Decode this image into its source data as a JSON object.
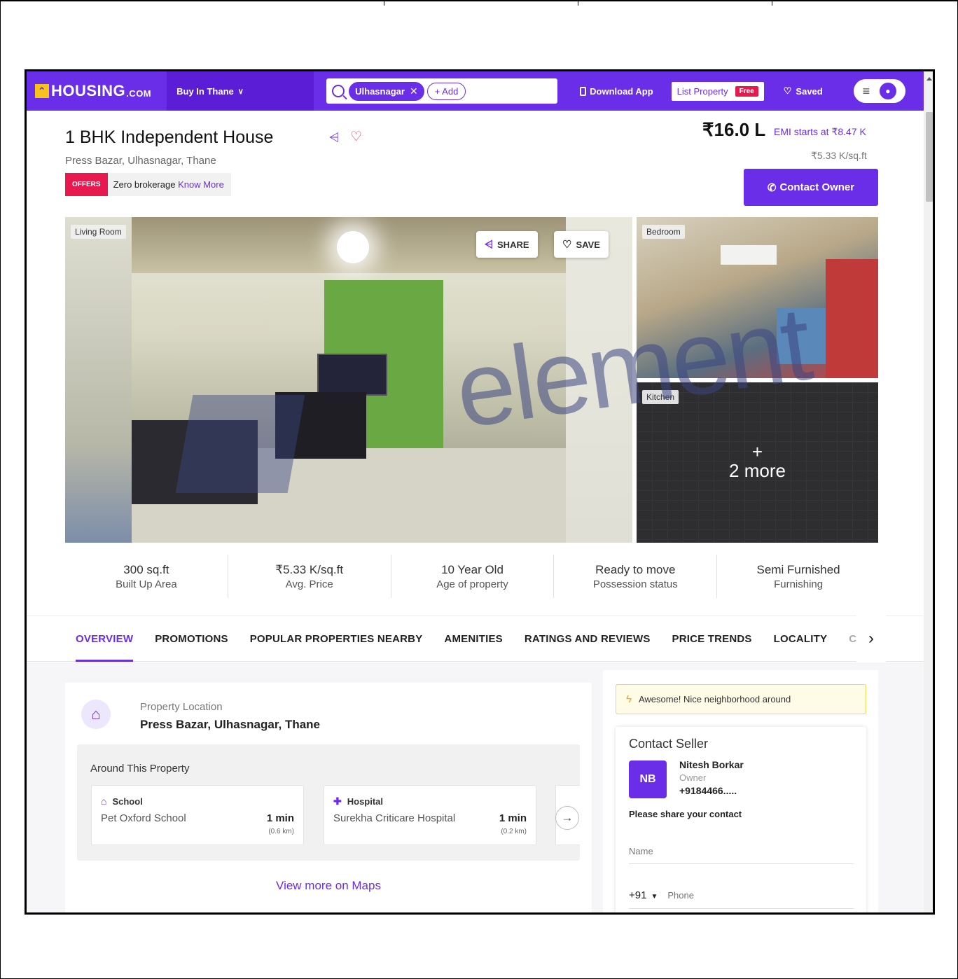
{
  "nav": {
    "logo_text": "HOUSING",
    "logo_suffix": ".COM",
    "city_label": "Buy In Thane",
    "search_chip": "Ulhasnagar",
    "add_chip": "+ Add",
    "download_app": "Download App",
    "list_property": "List Property",
    "free_badge": "Free",
    "saved": "Saved"
  },
  "property": {
    "title": "1 BHK Independent House",
    "address": "Press Bazar, Ulhasnagar, Thane",
    "offers_badge": "OFFERS",
    "offers_text": "Zero brokerage",
    "offers_link": "Know More",
    "price": "₹16.0 L",
    "emi": "EMI starts at ₹8.47 K",
    "price_per_sqft": "₹5.33 K/sq.ft",
    "contact_button": "Contact Owner"
  },
  "gallery": {
    "main_label": "Living Room",
    "share_button": "SHARE",
    "save_button": "SAVE",
    "bedroom_label": "Bedroom",
    "kitchen_label": "Kitchen",
    "more_plus": "+",
    "more_text": "2 more"
  },
  "stats": [
    {
      "value": "300 sq.ft",
      "label": "Built Up Area"
    },
    {
      "value": "₹5.33 K/sq.ft",
      "label": "Avg. Price"
    },
    {
      "value": "10 Year Old",
      "label": "Age of property"
    },
    {
      "value": "Ready to move",
      "label": "Possession status"
    },
    {
      "value": "Semi Furnished",
      "label": "Furnishing"
    }
  ],
  "tabs": [
    "OVERVIEW",
    "PROMOTIONS",
    "POPULAR PROPERTIES NEARBY",
    "AMENITIES",
    "RATINGS AND REVIEWS",
    "PRICE TRENDS",
    "LOCALITY",
    "CAL"
  ],
  "location": {
    "label": "Property Location",
    "value": "Press Bazar, Ulhasnagar, Thane",
    "around_title": "Around This Property",
    "pois": [
      {
        "category": "School",
        "name": "Pet Oxford School",
        "time": "1 min",
        "distance": "(0.6 km)"
      },
      {
        "category": "Hospital",
        "name": "Surekha Criticare Hospital",
        "time": "1 min",
        "distance": "(0.2 km)"
      }
    ],
    "view_maps": "View more on Maps"
  },
  "sidebar": {
    "neighborhood": "Awesome! Nice neighborhood around",
    "contact_title": "Contact Seller",
    "initials": "NB",
    "seller_name": "Nitesh Borkar",
    "seller_role": "Owner",
    "seller_phone": "+9184466.....",
    "share_contact": "Please share your contact",
    "name_placeholder": "Name",
    "country_code": "+91",
    "phone_placeholder": "Phone"
  },
  "watermark": "element",
  "colors": {
    "brand": "#6b2ee8",
    "accent_red": "#e8194f",
    "logo_yellow": "#f7c21a"
  }
}
